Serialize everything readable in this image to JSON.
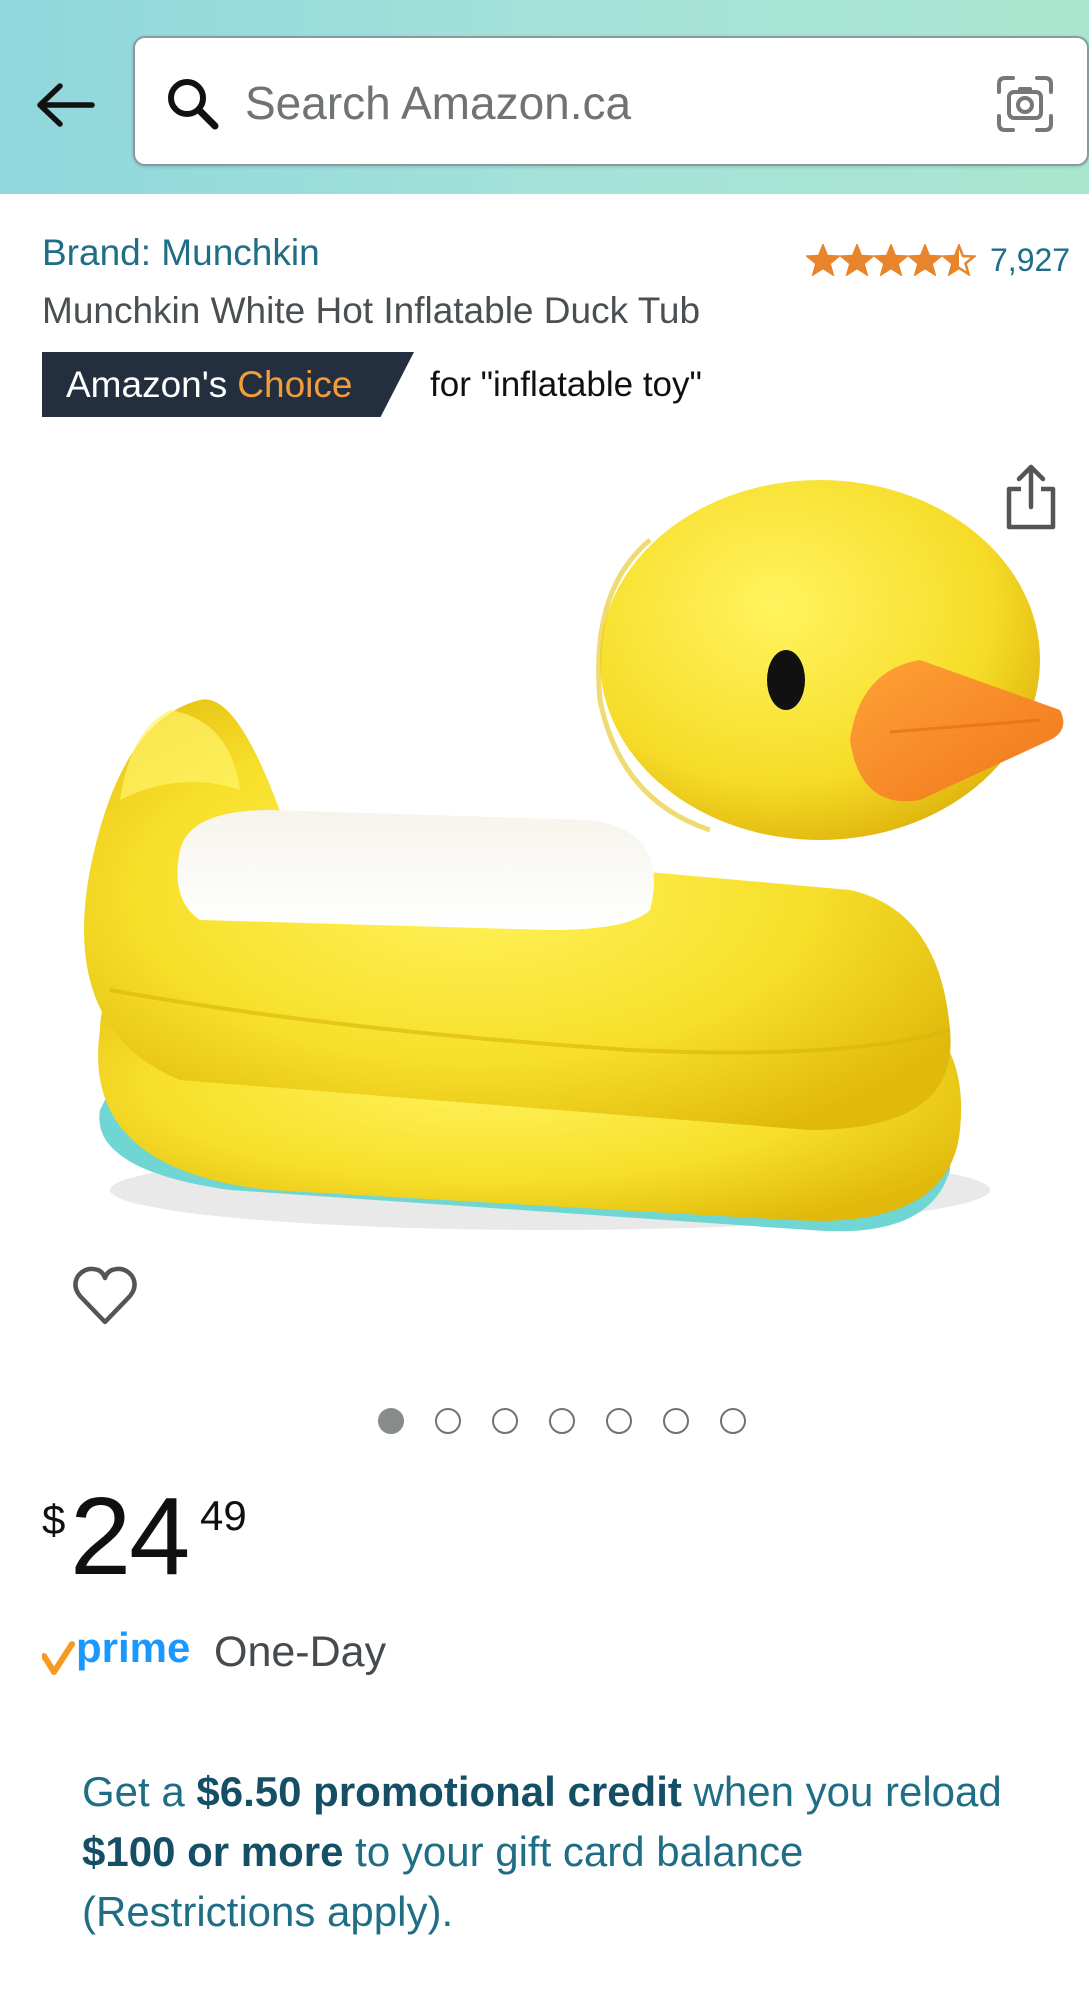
{
  "search": {
    "placeholder": "Search Amazon.ca"
  },
  "product": {
    "brand": "Brand: Munchkin",
    "title": "Munchkin White Hot Inflatable Duck Tub",
    "rating_value": 4.5,
    "review_count": "7,927",
    "choice_prefix": "Amazon's",
    "choice_highlight": "Choice",
    "choice_context": "for \"inflatable toy\"",
    "image_count": 7,
    "current_image_index": 0
  },
  "price": {
    "symbol": "$",
    "whole": "24",
    "fraction": "49"
  },
  "delivery": {
    "prime_label": "prime",
    "speed": "One-Day"
  },
  "promo": {
    "part1": "Get a ",
    "bold1": "$6.50 promotional credit",
    "part2": " when you reload ",
    "bold2": "$100 or more",
    "part3": " to your gift card balance (Restrictions apply)."
  },
  "colors": {
    "link": "#1f6e86",
    "badge_dark": "#232f3e",
    "badge_orange": "#f39c3a",
    "star": "#e8842b",
    "prime_blue": "#1a98ff",
    "prime_check": "#f59b23"
  },
  "icons": [
    "back-arrow-icon",
    "search-icon",
    "camera-icon",
    "star-icon",
    "share-icon",
    "heart-icon",
    "prime-check-icon"
  ]
}
